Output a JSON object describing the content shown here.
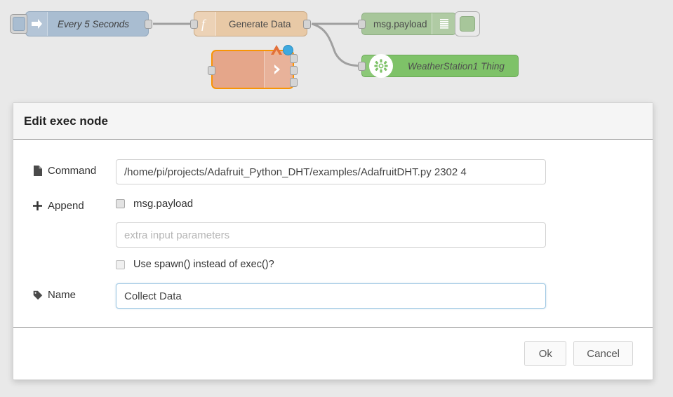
{
  "flow": {
    "nodes": [
      {
        "id": "inject",
        "label": "Every 5 Seconds",
        "icon": "inject-arrow-icon",
        "color": "#a9bdd1"
      },
      {
        "id": "function",
        "label": "Generate Data",
        "icon": "function-f-icon",
        "color": "#e8c9a6"
      },
      {
        "id": "exec",
        "label": "",
        "icon": "exec-arrow-icon",
        "color": "#e5a68a",
        "selected": true,
        "badge": "warning-triangle-icon",
        "status": "blue-dot"
      },
      {
        "id": "debug",
        "label": "msg.payload",
        "icon": "debug-lines-icon",
        "color": "#a7c69a"
      },
      {
        "id": "thing",
        "label": "WeatherStation1 Thing",
        "icon": "gear-icon",
        "color": "#7ec268"
      }
    ]
  },
  "dialog": {
    "title": "Edit exec node",
    "command": {
      "label": "Command",
      "icon": "file-icon",
      "value": "/home/pi/projects/Adafruit_Python_DHT/examples/AdafruitDHT.py 2302 4"
    },
    "append": {
      "label": "Append",
      "icon": "plus-icon",
      "checkbox_label": "msg.payload",
      "extra_placeholder": "extra input parameters",
      "extra_value": "",
      "spawn_label": "Use spawn() instead of exec()?"
    },
    "name": {
      "label": "Name",
      "icon": "tag-icon",
      "value": "Collect Data"
    },
    "footer": {
      "ok_label": "Ok",
      "cancel_label": "Cancel"
    }
  }
}
